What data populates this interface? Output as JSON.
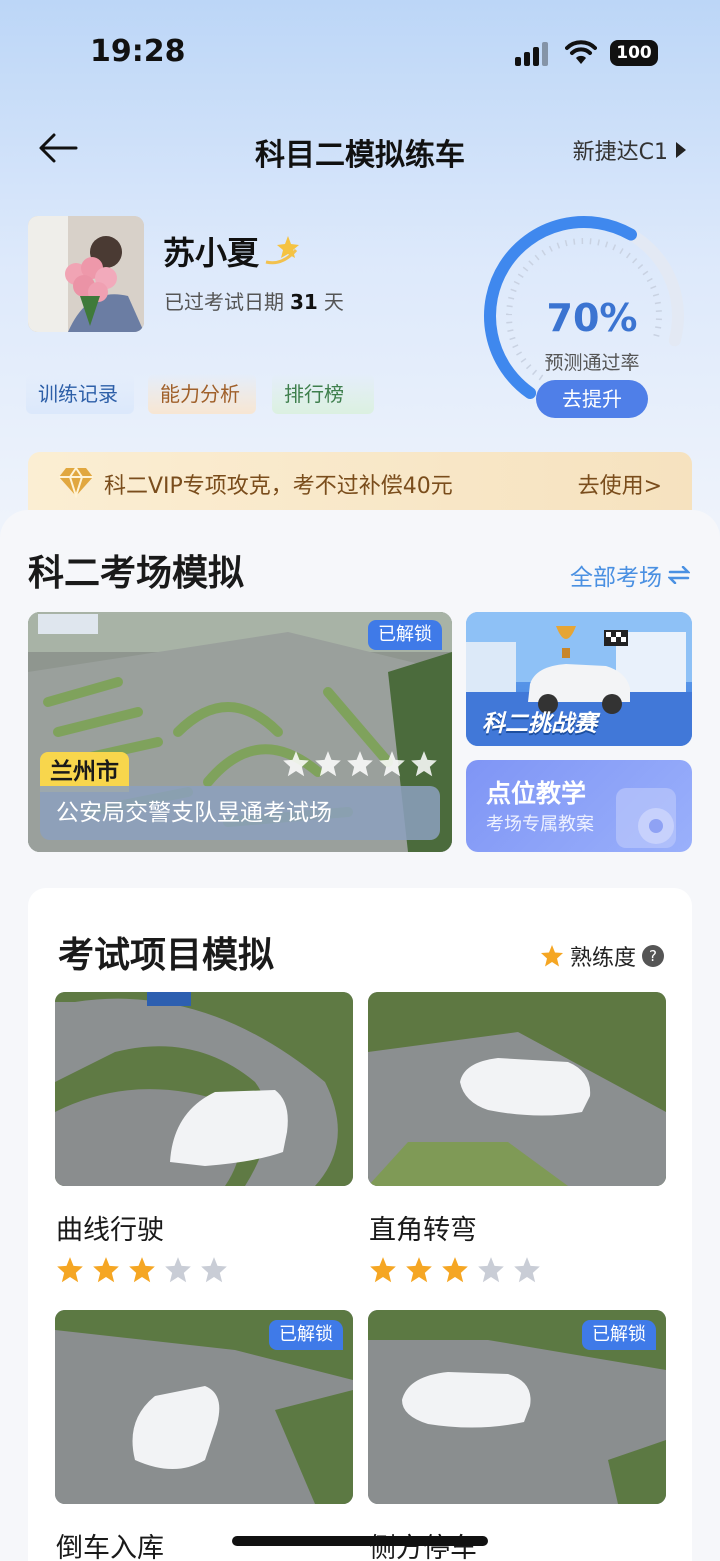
{
  "status": {
    "time": "19:28",
    "battery": "100"
  },
  "nav": {
    "title": "科目二模拟练车",
    "car": "新捷达C1"
  },
  "profile": {
    "name": "苏小夏",
    "exam_prefix": "已过考试日期",
    "exam_days": "31",
    "exam_suffix": "天",
    "tabs": [
      "训练记录",
      "能力分析",
      "排行榜"
    ]
  },
  "gauge": {
    "value": "70%",
    "percent": 70,
    "label": "预测通过率",
    "button": "去提升"
  },
  "vip": {
    "text": "科二VIP专项攻克，考不过补偿40元",
    "action": "去使用>"
  },
  "venue": {
    "section_title": "科二考场模拟",
    "all_label": "全部考场",
    "unlocked_label": "已解锁",
    "city": "兰州市",
    "place": "公安局交警支队昱通考试场",
    "stars": 5,
    "stars_filled": 0,
    "challenge_title": "科二挑战赛",
    "teach_title": "点位教学",
    "teach_sub": "考场专属教案"
  },
  "items": {
    "title": "考试项目模拟",
    "proficiency": "熟练度",
    "help": "?",
    "list": [
      {
        "name": "曲线行驶",
        "stars_filled": 3,
        "unlocked": ""
      },
      {
        "name": "直角转弯",
        "stars_filled": 3,
        "unlocked": ""
      },
      {
        "name": "倒车入库",
        "stars_filled": 0,
        "unlocked": "已解锁"
      },
      {
        "name": "侧方停车",
        "stars_filled": 0,
        "unlocked": "已解锁"
      }
    ]
  },
  "colors": {
    "accent": "#4f7fe8",
    "star_on": "#f5a623",
    "star_off": "#c9cdd6"
  }
}
